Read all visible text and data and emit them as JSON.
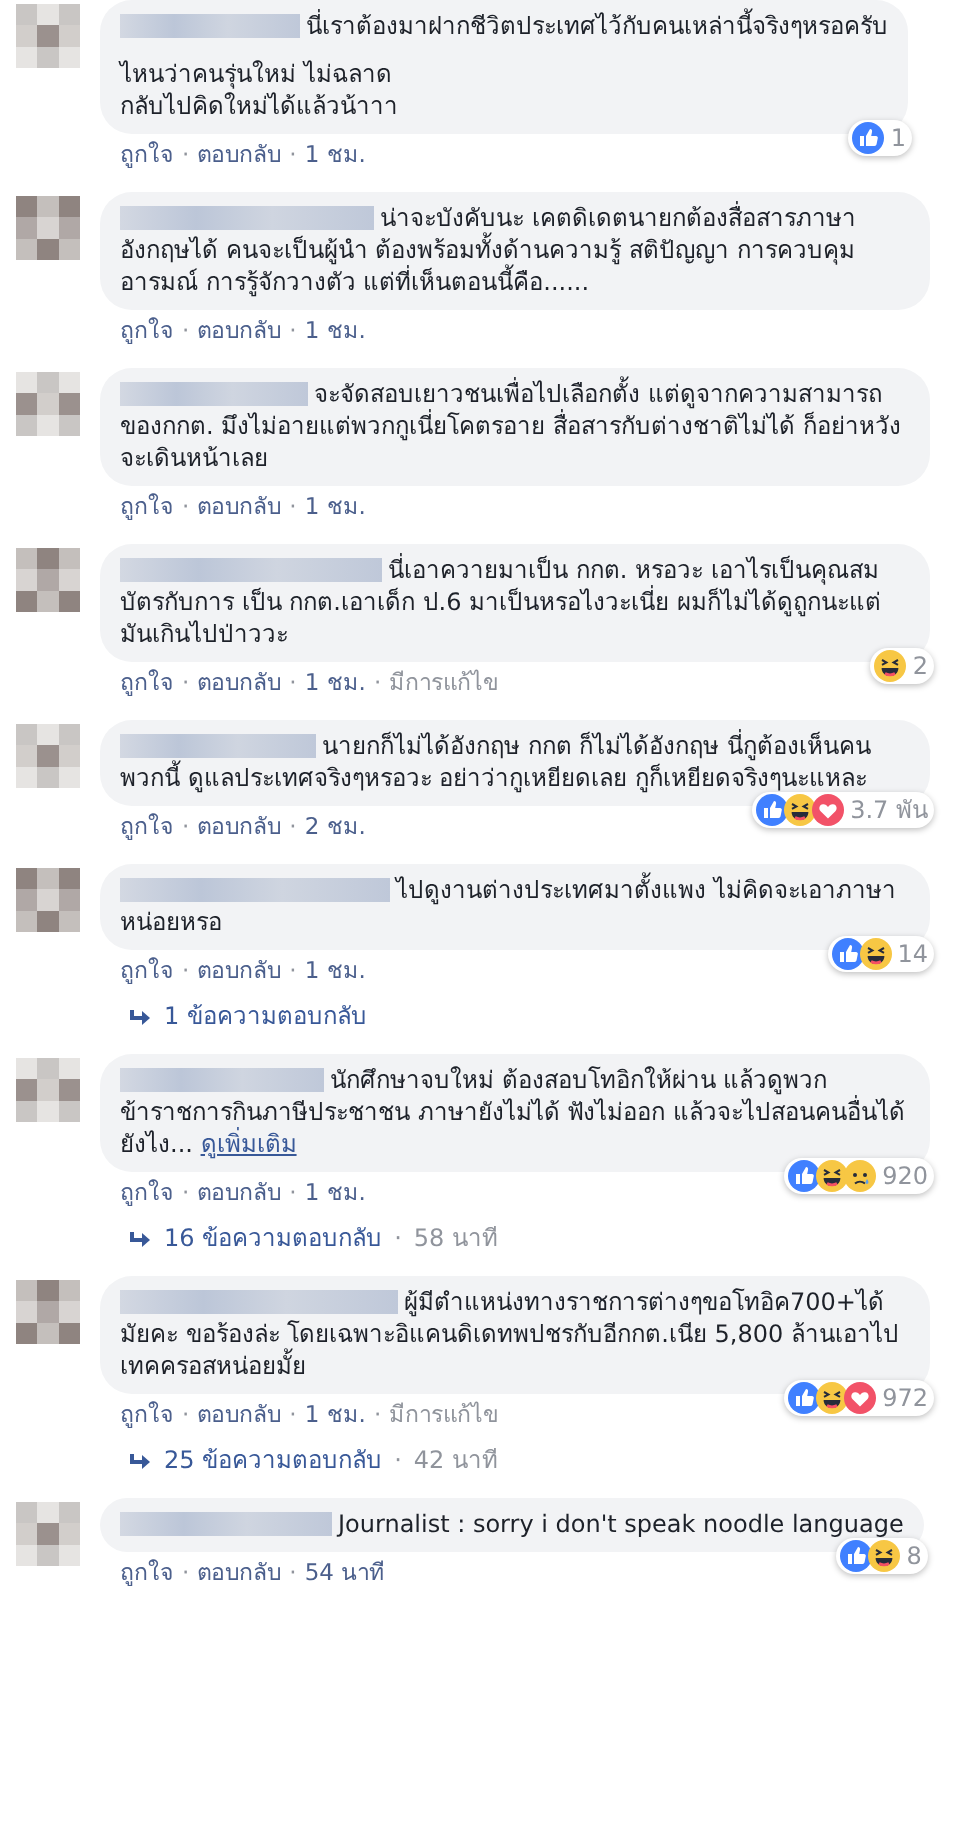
{
  "separator": "·",
  "comments": [
    {
      "paragraphs": [
        "นี่เราต้องมาฝากชีวิตประเทศไว้กับคนเหล่านี้จริงๆหรอครับ",
        "ไหนว่าคนรุ่นใหม่ ไม่ฉลาด\nกลับไปคิดใหม่ได้แล้วน้าาา"
      ],
      "reactions": {
        "icons": [
          {
            "kind": "like"
          }
        ],
        "count": "1"
      },
      "actions": [
        {
          "kind": "link",
          "text": "ถูกใจ"
        },
        {
          "kind": "link",
          "text": "ตอบกลับ"
        },
        {
          "kind": "time",
          "text": "1 ชม."
        }
      ]
    },
    {
      "paragraphs": [
        "น่าจะบังคับนะ เคตดิเดตนายกต้องสื่อสารภาษาอังกฤษได้ คนจะเป็นผู้นำ ต้องพร้อมทั้งด้านความรู้ สติปัญญา การควบคุมอารมณ์ การรู้จักวางตัว แต่ที่เห็นตอนนี้คือ......"
      ],
      "actions": [
        {
          "kind": "link",
          "text": "ถูกใจ"
        },
        {
          "kind": "link",
          "text": "ตอบกลับ"
        },
        {
          "kind": "time",
          "text": "1 ชม."
        }
      ]
    },
    {
      "paragraphs": [
        "จะจัดสอบเยาวชนเพื่อไปเลือกตั้ง แต่ดูจากความสามารถของกกต. มึงไม่อายแต่พวกกูเนี่ยโคตรอาย สื่อสารกับต่างชาติไม่ได้ ก็อย่าหวังจะเดินหน้าเลย"
      ],
      "actions": [
        {
          "kind": "link",
          "text": "ถูกใจ"
        },
        {
          "kind": "link",
          "text": "ตอบกลับ"
        },
        {
          "kind": "time",
          "text": "1 ชม."
        }
      ]
    },
    {
      "paragraphs": [
        "นี่เอาควายมาเป็น กกต. หรอวะ เอาไรเป็นคุณสมบัตรกับการ เป็น กกต.เอาเด็ก ป.6 มาเป็นหรอไงวะเนี่ย ผมก็ไม่ได้ดูถูกนะแต่มันเกินไปป่าววะ"
      ],
      "reactions": {
        "icons": [
          {
            "kind": "haha"
          }
        ],
        "count": "2"
      },
      "actions": [
        {
          "kind": "link",
          "text": "ถูกใจ"
        },
        {
          "kind": "link",
          "text": "ตอบกลับ"
        },
        {
          "kind": "time",
          "text": "1 ชม."
        },
        {
          "kind": "edited",
          "text": "มีการแก้ไข"
        }
      ]
    },
    {
      "paragraphs": [
        "นายกก็ไม่ได้อังกฤษ กกต ก็ไม่ได้อังกฤษ นี่กูต้องเห็นคนพวกนี้ ดูแลประเทศจริงๆหรอวะ อย่าว่ากูเหยียดเลย กูก็เหยียดจริงๆนะแหละ"
      ],
      "reactions": {
        "icons": [
          {
            "kind": "like"
          },
          {
            "kind": "haha"
          },
          {
            "kind": "love"
          }
        ],
        "count": "3.7 พัน"
      },
      "actions": [
        {
          "kind": "link",
          "text": "ถูกใจ"
        },
        {
          "kind": "link",
          "text": "ตอบกลับ"
        },
        {
          "kind": "time",
          "text": "2 ชม."
        }
      ]
    },
    {
      "paragraphs": [
        "ไปดูงานต่างประเทศมาตั้งแพง ไม่คิดจะเอาภาษาหน่อยหรอ"
      ],
      "reactions": {
        "icons": [
          {
            "kind": "like"
          },
          {
            "kind": "haha"
          }
        ],
        "count": "14"
      },
      "actions": [
        {
          "kind": "link",
          "text": "ถูกใจ"
        },
        {
          "kind": "link",
          "text": "ตอบกลับ"
        },
        {
          "kind": "time",
          "text": "1 ชม."
        }
      ],
      "replies": {
        "text": "1 ข้อความตอบกลับ"
      }
    },
    {
      "paragraphs": [
        "นักศึกษาจบใหม่ ต้องสอบโทอิกให้ผ่าน แล้วดูพวกข้าราชการกินภาษีประชาชน ภาษายังไม่ได้ ฟังไม่ออก แล้วจะไปสอนคนอื่นได้ยังไง..."
      ],
      "see_more": "ดูเพิ่มเติม",
      "reactions": {
        "icons": [
          {
            "kind": "like"
          },
          {
            "kind": "haha"
          },
          {
            "kind": "sad"
          }
        ],
        "count": "920"
      },
      "actions": [
        {
          "kind": "link",
          "text": "ถูกใจ"
        },
        {
          "kind": "link",
          "text": "ตอบกลับ"
        },
        {
          "kind": "time",
          "text": "1 ชม."
        }
      ],
      "replies": {
        "text": "16 ข้อความตอบกลับ",
        "time": "58 นาที"
      }
    },
    {
      "paragraphs": [
        "ผู้มีตำแหน่งทางราชการต่างๆขอโทอิค700+ได้มัยคะ ขอร้องล่ะ โดยเฉพาะอิแคนดิเดทพปชรกับอีกกต.เนีย 5,800 ล้านเอาไปเทคครอสหน่อยมั้ย"
      ],
      "reactions": {
        "icons": [
          {
            "kind": "like"
          },
          {
            "kind": "haha"
          },
          {
            "kind": "love"
          }
        ],
        "count": "972"
      },
      "actions": [
        {
          "kind": "link",
          "text": "ถูกใจ"
        },
        {
          "kind": "link",
          "text": "ตอบกลับ"
        },
        {
          "kind": "time",
          "text": "1 ชม."
        },
        {
          "kind": "edited",
          "text": "มีการแก้ไข"
        }
      ],
      "replies": {
        "text": "25 ข้อความตอบกลับ",
        "time": "42 นาที"
      }
    },
    {
      "paragraphs": [
        "Journalist : sorry i don't speak noodle language"
      ],
      "reactions": {
        "icons": [
          {
            "kind": "like"
          },
          {
            "kind": "haha"
          }
        ],
        "count": "8"
      },
      "actions": [
        {
          "kind": "link",
          "text": "ถูกใจ"
        },
        {
          "kind": "link",
          "text": "ตอบกลับ"
        },
        {
          "kind": "time",
          "text": "54 นาที"
        }
      ]
    }
  ]
}
